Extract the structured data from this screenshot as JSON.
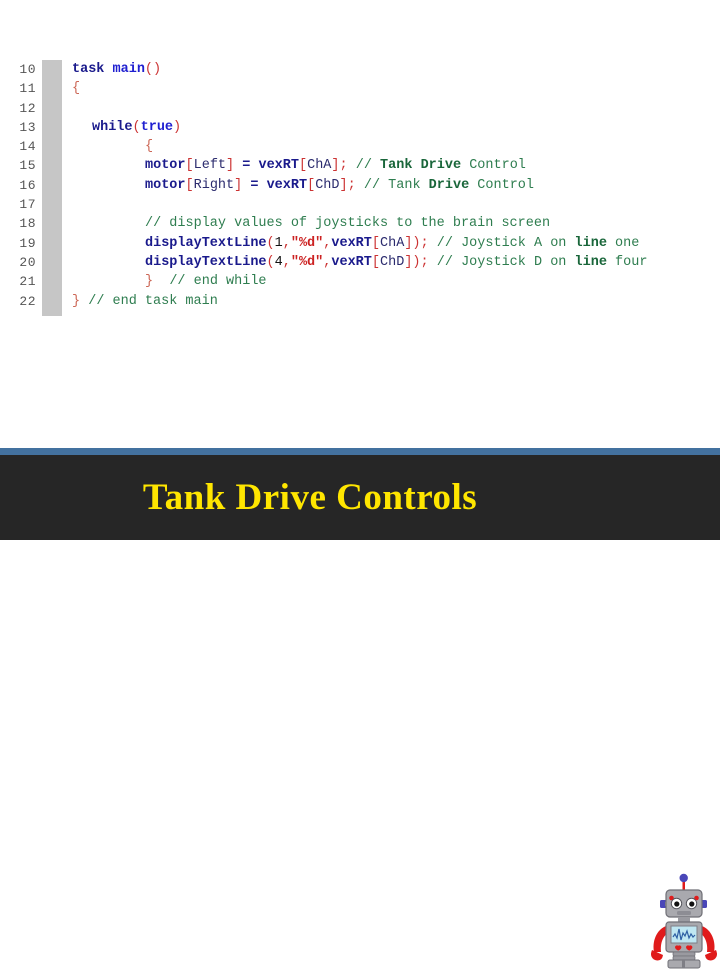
{
  "editor": {
    "name": "code-editor-pane",
    "language": "ROBOTC",
    "first_line_number": 10,
    "line_numbers": [
      "10",
      "11",
      "12",
      "13",
      "14",
      "15",
      "16",
      "17",
      "18",
      "19",
      "20",
      "21",
      "22"
    ],
    "lines": [
      {
        "n": "10",
        "text": "task main()"
      },
      {
        "n": "11",
        "text": "{"
      },
      {
        "n": "12",
        "text": ""
      },
      {
        "n": "13",
        "text": "  while(true)"
      },
      {
        "n": "14",
        "text": "      {"
      },
      {
        "n": "15",
        "text": "      motor[Left] = vexRT[ChA]; // Tank Drive Control"
      },
      {
        "n": "16",
        "text": "      motor[Right] = vexRT[ChD]; // Tank Drive Control"
      },
      {
        "n": "17",
        "text": ""
      },
      {
        "n": "18",
        "text": "      // display values of joysticks to the brain screen"
      },
      {
        "n": "19",
        "text": "      displayTextLine(1,\"%d\",vexRT[ChA]); // Joystick A on line one"
      },
      {
        "n": "20",
        "text": "      displayTextLine(4,\"%d\",vexRT[ChD]); // Joystick D on line four"
      },
      {
        "n": "21",
        "text": "      } // end while"
      },
      {
        "n": "22",
        "text": "} // end task main"
      }
    ],
    "tokens": {
      "task": "task",
      "main": "main",
      "open_paren": "(",
      "close_paren": ")",
      "open_brace": "{",
      "close_brace": "}",
      "while": "while",
      "true": "true",
      "motor": "motor",
      "vexRT": "vexRT",
      "displayTextLine": "displayTextLine",
      "left": "Left",
      "right": "Right",
      "chA": "ChA",
      "chD": "ChD",
      "open_bracket": "[",
      "close_bracket": "]",
      "assign": "=",
      "semicolon": ";",
      "comma": ",",
      "format_string": "\"%d\"",
      "arg_one": "1",
      "arg_four": "4",
      "comment_tank_drive": "// Tank Drive Control",
      "comment_display": "// display values of joysticks to the brain screen",
      "comment_joystick_a": "// Joystick A on line one",
      "comment_joystick_d": "// Joystick D on line four",
      "comment_end_while": "// end while",
      "comment_end_task": "// end task main"
    },
    "comment_parts": {
      "slashes": "//",
      "tank": "Tank",
      "drive": "Drive",
      "control": "Control",
      "display": "display values of joysticks to the brain screen",
      "joystick": "Joystick",
      "a": "A",
      "d": "D",
      "on": "on",
      "line": "line",
      "one": "one",
      "four": "four",
      "end": "end",
      "while_word": "while",
      "task_word": "task",
      "main_word": "main"
    }
  },
  "banner": {
    "title": "Tank Drive Controls",
    "stripe_color": "#43719f",
    "background_color": "#262626",
    "title_color": "#ffe600"
  },
  "robot": {
    "label": "robot-mascot",
    "body_color": "#a9a9ae",
    "arm_color": "#e01b1b",
    "antenna_ball_color": "#4a47b8",
    "screen_color": "#bfe7f2"
  }
}
